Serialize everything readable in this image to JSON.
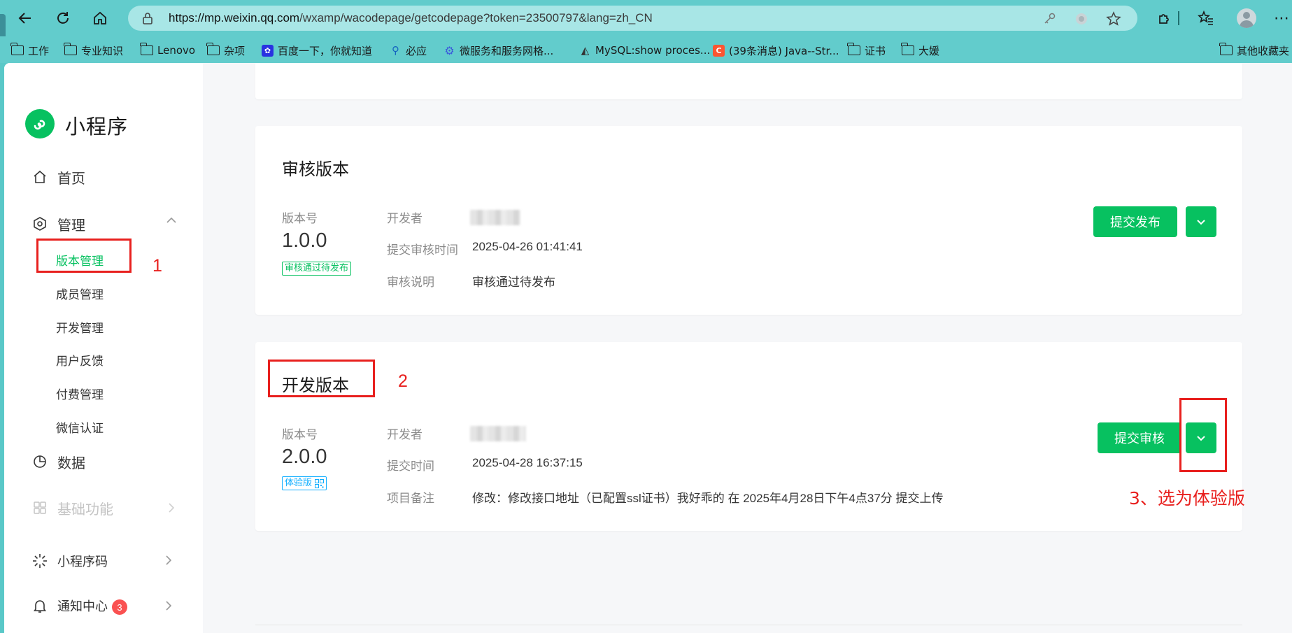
{
  "browser": {
    "url_host": "https://mp.weixin.qq.com",
    "url_path": "/wxamp/wacodepage/getcodepage?token=23500797&lang=zh_CN",
    "bookmarks": [
      {
        "label": "工作",
        "type": "folder"
      },
      {
        "label": "专业知识",
        "type": "folder"
      },
      {
        "label": "Lenovo",
        "type": "folder"
      },
      {
        "label": "杂项",
        "type": "folder"
      },
      {
        "label": "百度一下，你就知道",
        "type": "site"
      },
      {
        "label": "必应",
        "type": "site"
      },
      {
        "label": "微服务和服务网格...",
        "type": "site"
      },
      {
        "label": "MySQL:show proces...",
        "type": "site"
      },
      {
        "label": "(39条消息) Java--Str...",
        "type": "site"
      },
      {
        "label": "证书",
        "type": "folder"
      },
      {
        "label": "大媛",
        "type": "folder"
      },
      {
        "label": "其他收藏夹",
        "type": "folder"
      }
    ]
  },
  "sidebar": {
    "logo_text": "小程序",
    "home": "首页",
    "manage": "管理",
    "manage_items": [
      "版本管理",
      "成员管理",
      "开发管理",
      "用户反馈",
      "付费管理",
      "微信认证"
    ],
    "data": "数据",
    "basic": "基础功能",
    "qrcode": "小程序码",
    "notice": "通知中心",
    "notice_badge": "3"
  },
  "review_card": {
    "title": "审核版本",
    "version_label": "版本号",
    "version": "1.0.0",
    "status_tag": "审核通过待发布",
    "developer_label": "开发者",
    "time_label": "提交审核时间",
    "time_value": "2025-04-26 01:41:41",
    "desc_label": "审核说明",
    "desc_value": "审核通过待发布",
    "publish_button": "提交发布"
  },
  "dev_card": {
    "title": "开发版本",
    "version_label": "版本号",
    "version": "2.0.0",
    "tag": "体验版",
    "developer_label": "开发者",
    "time_label": "提交时间",
    "time_value": "2025-04-28 16:37:15",
    "note_label": "项目备注",
    "note_value": "修改：修改接口地址（已配置ssl证书）我好乖的 在 2025年4月28日下午4点37分 提交上传",
    "submit_button": "提交审核"
  },
  "annotations": {
    "n1": "1",
    "n2": "2",
    "n3": "3、选为体验版"
  },
  "colors": {
    "brand_green": "#07c160",
    "annotation_red": "#e8201e",
    "browser_teal": "#62cccc"
  }
}
